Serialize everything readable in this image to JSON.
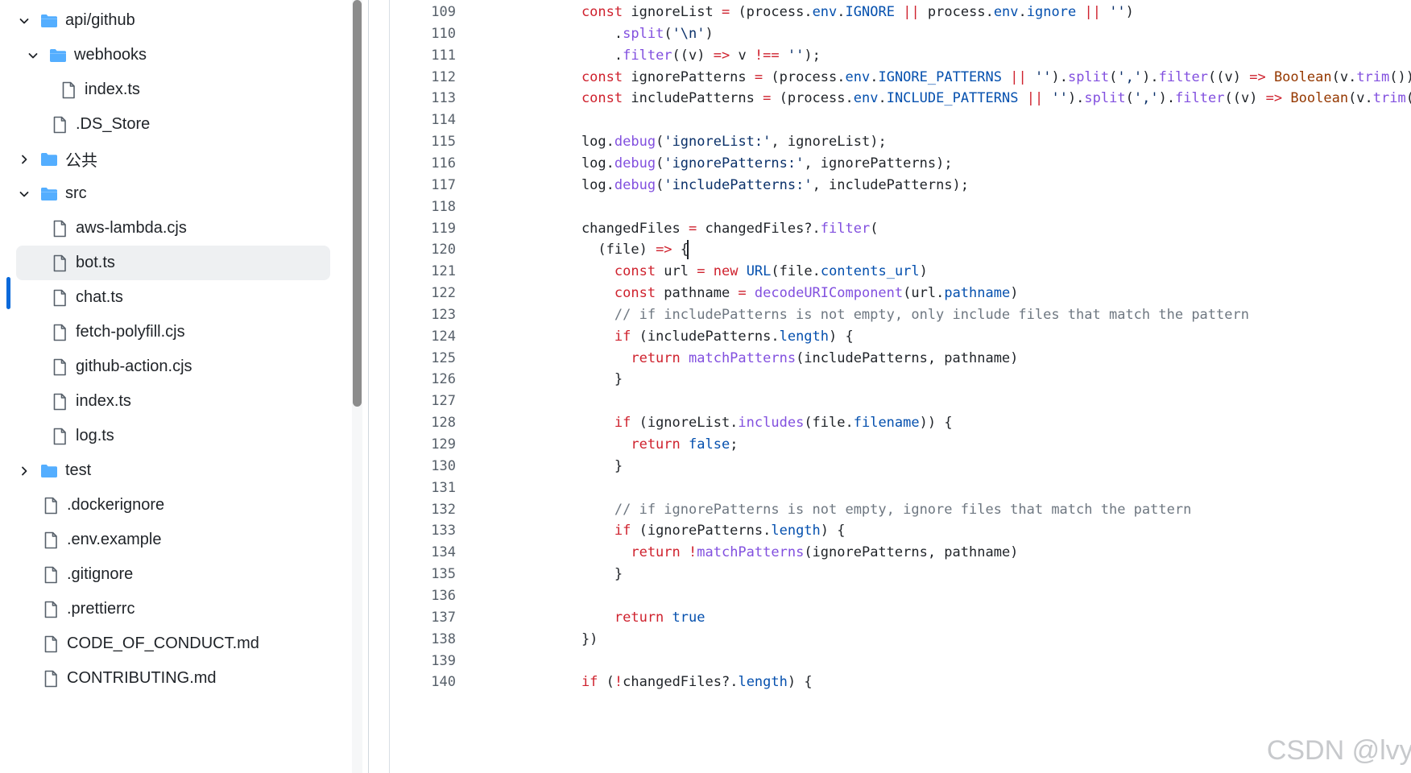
{
  "file_tree": [
    {
      "label": "api/github",
      "type": "folder",
      "expanded": true,
      "depth": 0
    },
    {
      "label": "webhooks",
      "type": "folder",
      "expanded": true,
      "depth": 1
    },
    {
      "label": "index.ts",
      "type": "file",
      "depth": 2
    },
    {
      "label": ".DS_Store",
      "type": "file",
      "depth": 1
    },
    {
      "label": "公共",
      "type": "folder",
      "expanded": false,
      "depth": 0
    },
    {
      "label": "src",
      "type": "folder",
      "expanded": true,
      "depth": 0
    },
    {
      "label": "aws-lambda.cjs",
      "type": "file",
      "depth": 1
    },
    {
      "label": "bot.ts",
      "type": "file",
      "depth": 1,
      "selected": true
    },
    {
      "label": "chat.ts",
      "type": "file",
      "depth": 1
    },
    {
      "label": "fetch-polyfill.cjs",
      "type": "file",
      "depth": 1
    },
    {
      "label": "github-action.cjs",
      "type": "file",
      "depth": 1
    },
    {
      "label": "index.ts",
      "type": "file",
      "depth": 1
    },
    {
      "label": "log.ts",
      "type": "file",
      "depth": 1
    },
    {
      "label": "test",
      "type": "folder",
      "expanded": false,
      "depth": 0
    },
    {
      "label": ".dockerignore",
      "type": "file",
      "depth": 0
    },
    {
      "label": ".env.example",
      "type": "file",
      "depth": 0
    },
    {
      "label": ".gitignore",
      "type": "file",
      "depth": 0
    },
    {
      "label": ".prettierrc",
      "type": "file",
      "depth": 0
    },
    {
      "label": "CODE_OF_CONDUCT.md",
      "type": "file",
      "depth": 0
    },
    {
      "label": "CONTRIBUTING.md",
      "type": "file",
      "depth": 0
    }
  ],
  "code": {
    "first_line": 109,
    "caret_line": 120,
    "lines": [
      [
        [
          "    const ",
          "kw"
        ],
        [
          "ignoreList ",
          ""
        ],
        [
          "= ",
          "kw"
        ],
        [
          "(process.",
          ""
        ],
        [
          "env",
          "prop"
        ],
        [
          ".",
          ""
        ],
        [
          "IGNORE",
          "prop"
        ],
        [
          " ",
          ""
        ],
        [
          "||",
          "kw"
        ],
        [
          " process.",
          ""
        ],
        [
          "env",
          "prop"
        ],
        [
          ".",
          ""
        ],
        [
          "ignore",
          "prop"
        ],
        [
          " ",
          ""
        ],
        [
          "||",
          "kw"
        ],
        [
          " ",
          ""
        ],
        [
          "''",
          "str"
        ],
        [
          ")",
          ""
        ]
      ],
      [
        [
          "        .",
          ""
        ],
        [
          "split",
          "fn"
        ],
        [
          "(",
          ""
        ],
        [
          "'\\n'",
          "str"
        ],
        [
          ")",
          ""
        ]
      ],
      [
        [
          "        .",
          ""
        ],
        [
          "filter",
          "fn"
        ],
        [
          "((v) ",
          ""
        ],
        [
          "=>",
          "kw"
        ],
        [
          " v ",
          ""
        ],
        [
          "!==",
          "kw"
        ],
        [
          " ",
          ""
        ],
        [
          "''",
          "str"
        ],
        [
          ");",
          ""
        ]
      ],
      [
        [
          "    const ",
          "kw"
        ],
        [
          "ignorePatterns ",
          ""
        ],
        [
          "= ",
          "kw"
        ],
        [
          "(process.",
          ""
        ],
        [
          "env",
          "prop"
        ],
        [
          ".",
          ""
        ],
        [
          "IGNORE_PATTERNS",
          "prop"
        ],
        [
          " ",
          ""
        ],
        [
          "||",
          "kw"
        ],
        [
          " ",
          ""
        ],
        [
          "''",
          "str"
        ],
        [
          ").",
          ""
        ],
        [
          "split",
          "fn"
        ],
        [
          "(",
          ""
        ],
        [
          "','",
          "str"
        ],
        [
          ").",
          ""
        ],
        [
          "filter",
          "fn"
        ],
        [
          "((v) ",
          ""
        ],
        [
          "=>",
          "kw"
        ],
        [
          " ",
          ""
        ],
        [
          "Boolean",
          "cls"
        ],
        [
          "(v.",
          ""
        ],
        [
          "trim",
          "fn"
        ],
        [
          "()));",
          ""
        ]
      ],
      [
        [
          "    const ",
          "kw"
        ],
        [
          "includePatterns ",
          ""
        ],
        [
          "= ",
          "kw"
        ],
        [
          "(process.",
          ""
        ],
        [
          "env",
          "prop"
        ],
        [
          ".",
          ""
        ],
        [
          "INCLUDE_PATTERNS",
          "prop"
        ],
        [
          " ",
          ""
        ],
        [
          "||",
          "kw"
        ],
        [
          " ",
          ""
        ],
        [
          "''",
          "str"
        ],
        [
          ").",
          ""
        ],
        [
          "split",
          "fn"
        ],
        [
          "(",
          ""
        ],
        [
          "','",
          "str"
        ],
        [
          ").",
          ""
        ],
        [
          "filter",
          "fn"
        ],
        [
          "((v) ",
          ""
        ],
        [
          "=>",
          "kw"
        ],
        [
          " ",
          ""
        ],
        [
          "Boolean",
          "cls"
        ],
        [
          "(v.",
          ""
        ],
        [
          "trim",
          "fn"
        ],
        [
          "()));",
          ""
        ]
      ],
      [],
      [
        [
          "    log.",
          ""
        ],
        [
          "debug",
          "fn"
        ],
        [
          "(",
          ""
        ],
        [
          "'ignoreList:'",
          "str"
        ],
        [
          ", ignoreList);",
          ""
        ]
      ],
      [
        [
          "    log.",
          ""
        ],
        [
          "debug",
          "fn"
        ],
        [
          "(",
          ""
        ],
        [
          "'ignorePatterns:'",
          "str"
        ],
        [
          ", ignorePatterns);",
          ""
        ]
      ],
      [
        [
          "    log.",
          ""
        ],
        [
          "debug",
          "fn"
        ],
        [
          "(",
          ""
        ],
        [
          "'includePatterns:'",
          "str"
        ],
        [
          ", includePatterns);",
          ""
        ]
      ],
      [],
      [
        [
          "    changedFiles ",
          ""
        ],
        [
          "=",
          "kw"
        ],
        [
          " changedFiles?.",
          ""
        ],
        [
          "filter",
          "fn"
        ],
        [
          "(",
          ""
        ]
      ],
      [
        [
          "      (file) ",
          ""
        ],
        [
          "=>",
          "kw"
        ],
        [
          " {",
          ""
        ]
      ],
      [
        [
          "        const ",
          "kw"
        ],
        [
          "url ",
          ""
        ],
        [
          "= ",
          "kw"
        ],
        [
          "new ",
          "kw"
        ],
        [
          "URL",
          "prop"
        ],
        [
          "(file.",
          ""
        ],
        [
          "contents_url",
          "prop"
        ],
        [
          ")",
          ""
        ]
      ],
      [
        [
          "        const ",
          "kw"
        ],
        [
          "pathname ",
          ""
        ],
        [
          "= ",
          "kw"
        ],
        [
          "decodeURIComponent",
          "fn"
        ],
        [
          "(url.",
          ""
        ],
        [
          "pathname",
          "prop"
        ],
        [
          ")",
          ""
        ]
      ],
      [
        [
          "        // if includePatterns is not empty, only include files that match the pattern",
          "com"
        ]
      ],
      [
        [
          "        if ",
          "kw"
        ],
        [
          "(includePatterns.",
          ""
        ],
        [
          "length",
          "prop"
        ],
        [
          ") {",
          ""
        ]
      ],
      [
        [
          "          return ",
          "kw"
        ],
        [
          "matchPatterns",
          "fn"
        ],
        [
          "(includePatterns, pathname)",
          ""
        ]
      ],
      [
        [
          "        }",
          ""
        ]
      ],
      [],
      [
        [
          "        if ",
          "kw"
        ],
        [
          "(ignoreList.",
          ""
        ],
        [
          "includes",
          "fn"
        ],
        [
          "(file.",
          ""
        ],
        [
          "filename",
          "prop"
        ],
        [
          ")) {",
          ""
        ]
      ],
      [
        [
          "          return ",
          "kw"
        ],
        [
          "false",
          "prop"
        ],
        [
          ";",
          ""
        ]
      ],
      [
        [
          "        }",
          ""
        ]
      ],
      [],
      [
        [
          "        // if ignorePatterns is not empty, ignore files that match the pattern",
          "com"
        ]
      ],
      [
        [
          "        if ",
          "kw"
        ],
        [
          "(ignorePatterns.",
          ""
        ],
        [
          "length",
          "prop"
        ],
        [
          ") {",
          ""
        ]
      ],
      [
        [
          "          return ",
          "kw"
        ],
        [
          "!",
          "kw"
        ],
        [
          "matchPatterns",
          "fn"
        ],
        [
          "(ignorePatterns, pathname)",
          ""
        ]
      ],
      [
        [
          "        }",
          ""
        ]
      ],
      [],
      [
        [
          "        return ",
          "kw"
        ],
        [
          "true",
          "prop"
        ]
      ],
      [
        [
          "    })",
          ""
        ]
      ],
      [],
      [
        [
          "    if ",
          "kw"
        ],
        [
          "(",
          ""
        ],
        [
          "!",
          "kw"
        ],
        [
          "changedFiles?.",
          ""
        ],
        [
          "length",
          "prop"
        ],
        [
          ") {",
          ""
        ]
      ]
    ]
  },
  "watermark": "CSDN @lvy-",
  "colors": {
    "folder": "#54aeff",
    "accent": "#0969da"
  }
}
